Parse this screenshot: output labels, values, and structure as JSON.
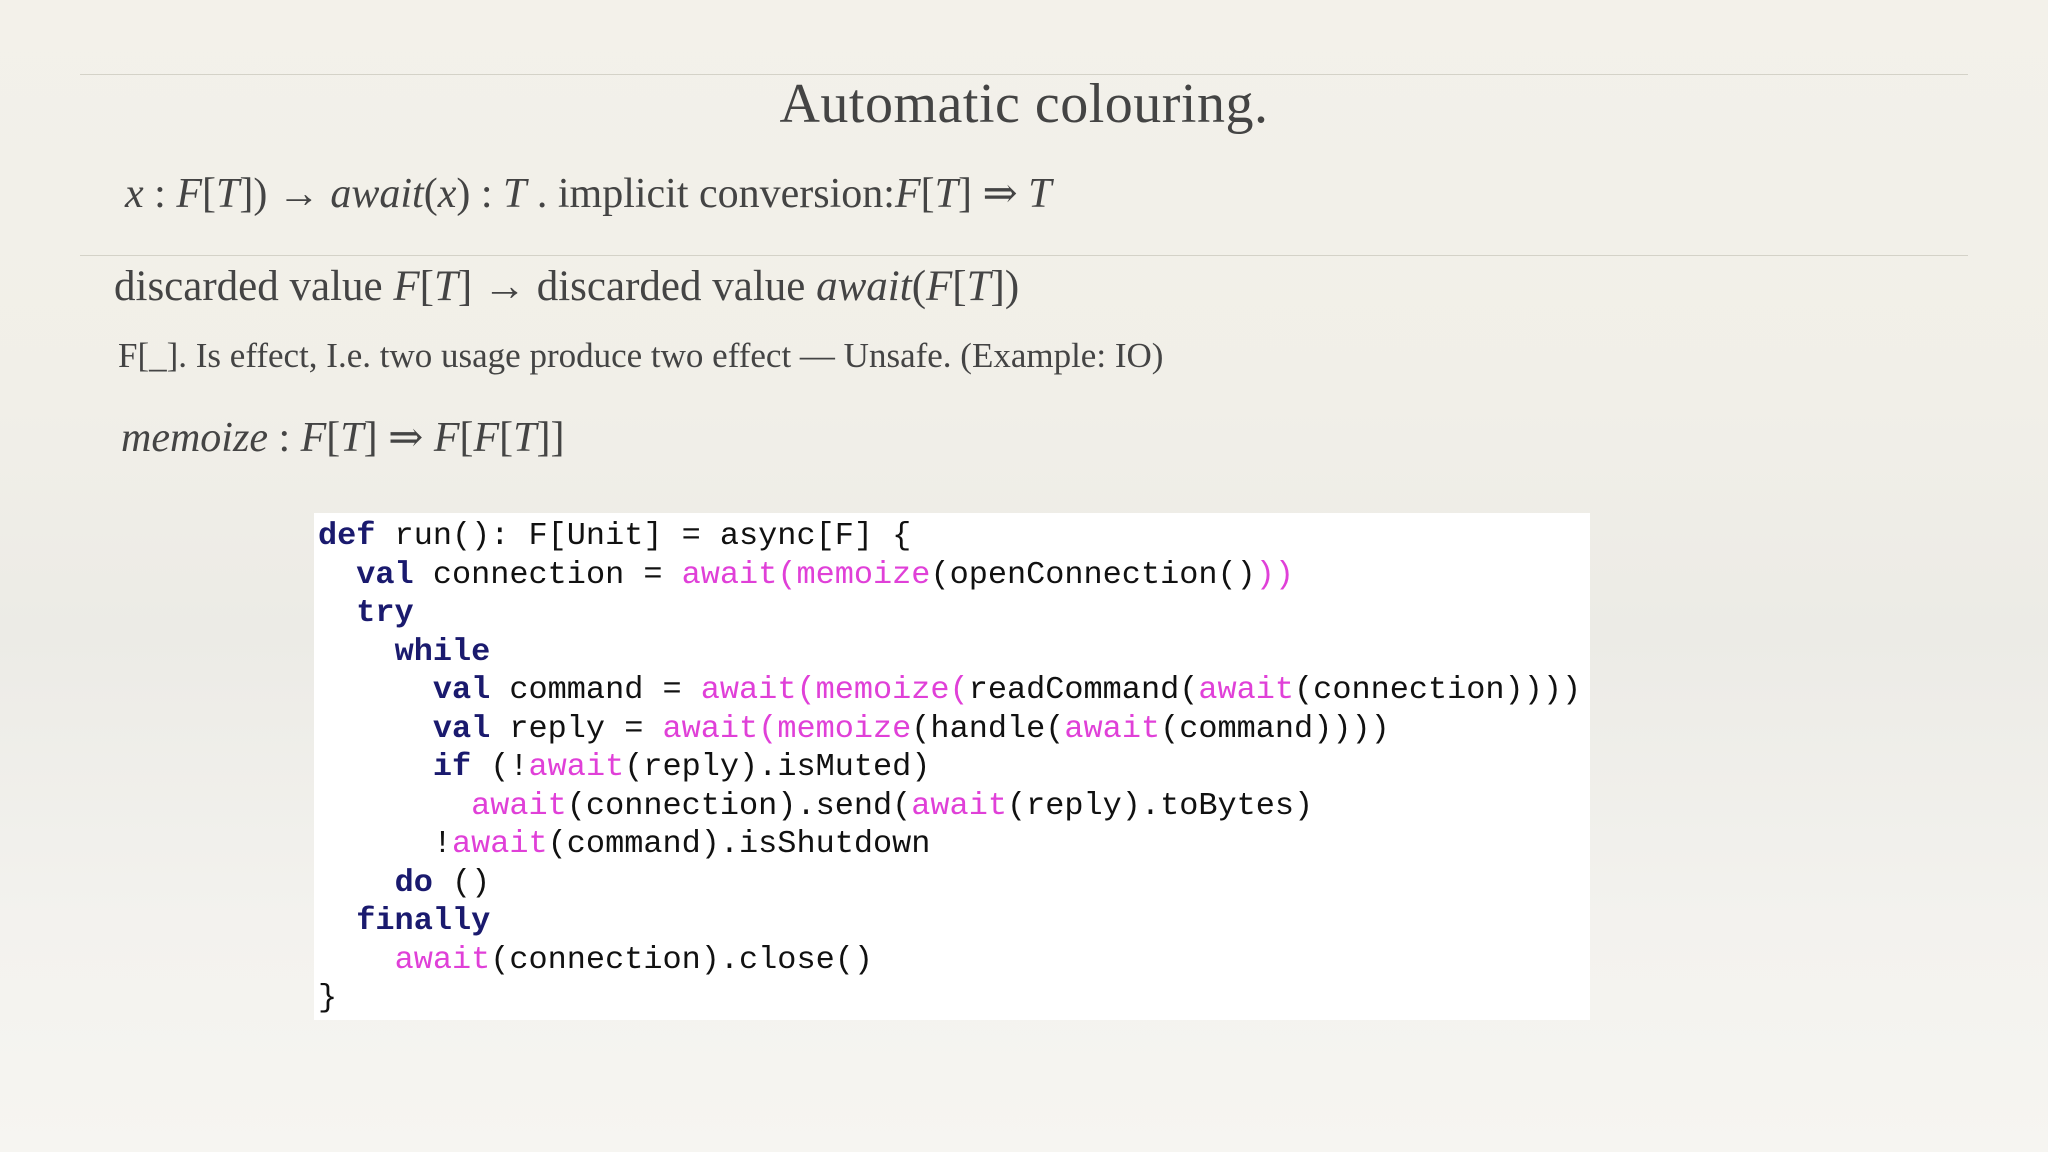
{
  "slide": {
    "title": "Automatic colouring.",
    "formula_line": [
      {
        "t": "x",
        "i": true
      },
      {
        "t": " : ",
        "i": false
      },
      {
        "t": "F",
        "i": true
      },
      {
        "t": "[",
        "i": false
      },
      {
        "t": "T",
        "i": true
      },
      {
        "t": "]) → ",
        "i": false
      },
      {
        "t": "await",
        "i": true
      },
      {
        "t": "(",
        "i": false
      },
      {
        "t": "x",
        "i": true
      },
      {
        "t": ") : ",
        "i": false
      },
      {
        "t": "T",
        "i": true
      },
      {
        "t": " . implicit conversion:",
        "i": false
      },
      {
        "t": "F",
        "i": true
      },
      {
        "t": "[",
        "i": false
      },
      {
        "t": "T",
        "i": true
      },
      {
        "t": "] ⇒ ",
        "i": false
      },
      {
        "t": "T",
        "i": true
      }
    ],
    "discard_line": [
      {
        "t": "discarded value ",
        "i": false
      },
      {
        "t": "F",
        "i": true
      },
      {
        "t": "[",
        "i": false
      },
      {
        "t": "T",
        "i": true
      },
      {
        "t": "] →  discarded value ",
        "i": false
      },
      {
        "t": "await",
        "i": true
      },
      {
        "t": "(",
        "i": false
      },
      {
        "t": "F",
        "i": true
      },
      {
        "t": "[",
        "i": false
      },
      {
        "t": "T",
        "i": true
      },
      {
        "t": "])",
        "i": false
      }
    ],
    "effect_line": "F[_]. Is effect,   I.e.   two usage produce two effect —  Unsafe.  (Example:   IO)",
    "memo_line": [
      {
        "t": "memoize",
        "i": true
      },
      {
        "t": " : ",
        "i": false
      },
      {
        "t": "F",
        "i": true
      },
      {
        "t": "[",
        "i": false
      },
      {
        "t": "T",
        "i": true
      },
      {
        "t": "] ⇒ ",
        "i": false
      },
      {
        "t": "F",
        "i": true
      },
      {
        "t": "[",
        "i": false
      },
      {
        "t": "F",
        "i": true
      },
      {
        "t": "[",
        "i": false
      },
      {
        "t": "T",
        "i": true
      },
      {
        "t": "]]",
        "i": false
      }
    ]
  },
  "code": {
    "colors": {
      "keyword": "#1a1a6e",
      "await": "#e040d8",
      "plain": "#111111"
    },
    "lines": [
      [
        {
          "t": "def",
          "c": "kw"
        },
        {
          "t": " run(): F[Unit] = async[F] {",
          "c": "pl"
        }
      ],
      [
        {
          "t": "  ",
          "c": "pl"
        },
        {
          "t": "val",
          "c": "kw"
        },
        {
          "t": " connection = ",
          "c": "pl"
        },
        {
          "t": "await(memoize",
          "c": "aw"
        },
        {
          "t": "(openConnection()",
          "c": "pl"
        },
        {
          "t": "))",
          "c": "aw"
        }
      ],
      [
        {
          "t": "  ",
          "c": "pl"
        },
        {
          "t": "try",
          "c": "kw"
        }
      ],
      [
        {
          "t": "    ",
          "c": "pl"
        },
        {
          "t": "while",
          "c": "kw"
        }
      ],
      [
        {
          "t": "      ",
          "c": "pl"
        },
        {
          "t": "val",
          "c": "kw"
        },
        {
          "t": " command = ",
          "c": "pl"
        },
        {
          "t": "await(memoize(",
          "c": "aw"
        },
        {
          "t": "readCommand(",
          "c": "pl"
        },
        {
          "t": "await",
          "c": "aw"
        },
        {
          "t": "(connection))))",
          "c": "pl"
        }
      ],
      [
        {
          "t": "      ",
          "c": "pl"
        },
        {
          "t": "val",
          "c": "kw"
        },
        {
          "t": " reply = ",
          "c": "pl"
        },
        {
          "t": "await(memoize",
          "c": "aw"
        },
        {
          "t": "(handle(",
          "c": "pl"
        },
        {
          "t": "await",
          "c": "aw"
        },
        {
          "t": "(command))))",
          "c": "pl"
        }
      ],
      [
        {
          "t": "      ",
          "c": "pl"
        },
        {
          "t": "if",
          "c": "kw"
        },
        {
          "t": " (!",
          "c": "pl"
        },
        {
          "t": "await",
          "c": "aw"
        },
        {
          "t": "(reply).isMuted)",
          "c": "pl"
        }
      ],
      [
        {
          "t": "        ",
          "c": "pl"
        },
        {
          "t": "await",
          "c": "aw"
        },
        {
          "t": "(connection).send(",
          "c": "pl"
        },
        {
          "t": "await",
          "c": "aw"
        },
        {
          "t": "(reply).toBytes)",
          "c": "pl"
        }
      ],
      [
        {
          "t": "      !",
          "c": "pl"
        },
        {
          "t": "await",
          "c": "aw"
        },
        {
          "t": "(command).isShutdown",
          "c": "pl"
        }
      ],
      [
        {
          "t": "    ",
          "c": "pl"
        },
        {
          "t": "do",
          "c": "kw"
        },
        {
          "t": " ()",
          "c": "pl"
        }
      ],
      [
        {
          "t": "  ",
          "c": "pl"
        },
        {
          "t": "finally",
          "c": "kw"
        }
      ],
      [
        {
          "t": "    ",
          "c": "pl"
        },
        {
          "t": "await",
          "c": "aw"
        },
        {
          "t": "(connection).close()",
          "c": "pl"
        }
      ],
      [
        {
          "t": "}",
          "c": "pl"
        }
      ]
    ]
  }
}
